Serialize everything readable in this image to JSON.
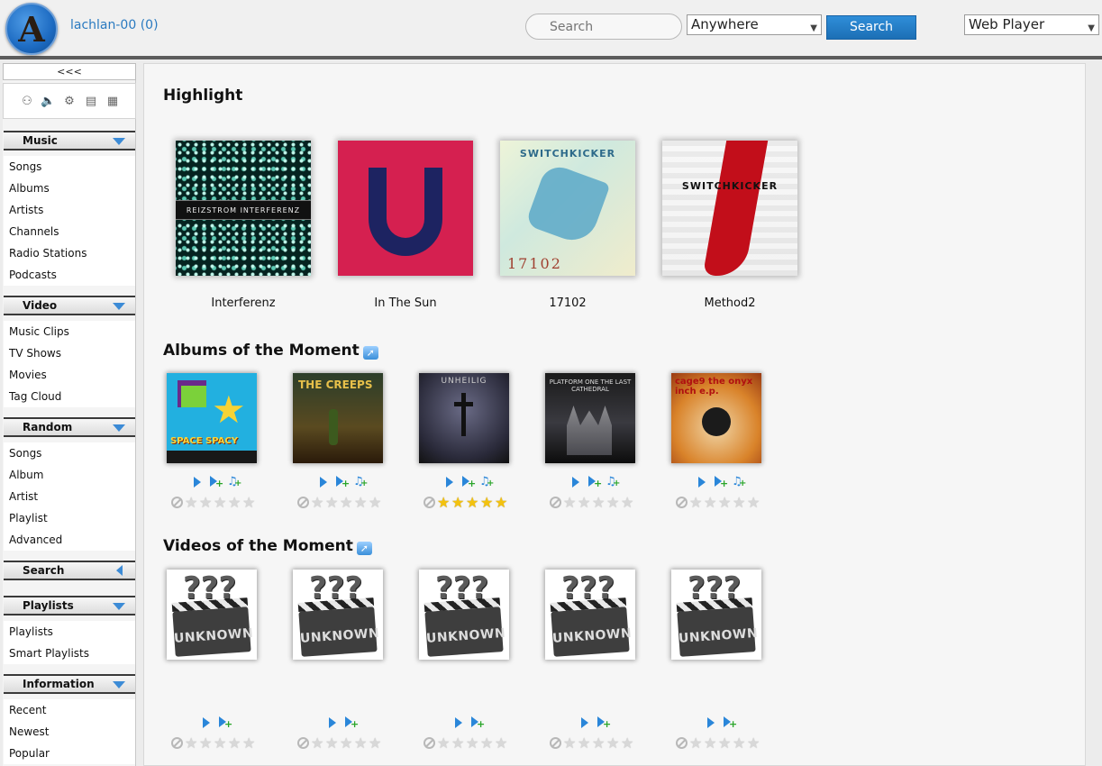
{
  "header": {
    "logo_letter": "A",
    "user_link": "lachlan-00 (0)",
    "search_placeholder": "Search",
    "scope_select": "Anywhere",
    "search_button": "Search",
    "player_select": "Web Player"
  },
  "sidebar": {
    "collapse_label": "<<<",
    "toolbar_icons": [
      "headphones-icon",
      "speaker-icon",
      "settings-icon",
      "server-icon",
      "logout-icon"
    ],
    "sections": [
      {
        "title": "Music",
        "items": [
          "Songs",
          "Albums",
          "Artists",
          "Channels",
          "Radio Stations",
          "Podcasts"
        ]
      },
      {
        "title": "Video",
        "items": [
          "Music Clips",
          "TV Shows",
          "Movies",
          "Tag Cloud"
        ]
      },
      {
        "title": "Random",
        "items": [
          "Songs",
          "Album",
          "Artist",
          "Playlist",
          "Advanced"
        ]
      },
      {
        "title": "Search",
        "items": []
      },
      {
        "title": "Playlists",
        "items": [
          "Playlists",
          "Smart Playlists"
        ]
      },
      {
        "title": "Information",
        "items": [
          "Recent",
          "Newest",
          "Popular"
        ]
      }
    ]
  },
  "main": {
    "highlight_heading": "Highlight",
    "highlights": [
      {
        "title": "Interferenz",
        "cover_text": "REIZSTROM INTERFERENZ"
      },
      {
        "title": "In The Sun",
        "cover_text": ""
      },
      {
        "title": "17102",
        "cover_text": "SWITCHKICKER",
        "cover_num": "17102"
      },
      {
        "title": "Method2",
        "cover_text": "SWITCHKICKER"
      }
    ],
    "albums_heading": "Albums of the Moment",
    "albums": [
      {
        "cover_text": "SPACE SPACY",
        "rating": 0
      },
      {
        "cover_text": "THE CREEPS",
        "rating": 0
      },
      {
        "cover_text": "UNHEILIG",
        "rating": 5
      },
      {
        "cover_text": "PLATFORM ONE THE LAST CATHEDRAL",
        "rating": 0
      },
      {
        "cover_text": "cage9 the onyx inch e.p.",
        "rating": 0
      }
    ],
    "videos_heading": "Videos of the Moment",
    "videos": [
      {
        "cover_text": "UNKNOWN",
        "rating": 0
      },
      {
        "cover_text": "UNKNOWN",
        "rating": 0
      },
      {
        "cover_text": "UNKNOWN",
        "rating": 0
      },
      {
        "cover_text": "UNKNOWN",
        "rating": 0
      },
      {
        "cover_text": "UNKNOWN",
        "rating": 0
      }
    ]
  },
  "colors": {
    "accent": "#2a86d9",
    "header_bg": "#f0f0f0",
    "header_border": "#5c5c5c",
    "star_on": "#f3c20e",
    "star_off": "#d8d8d8"
  }
}
